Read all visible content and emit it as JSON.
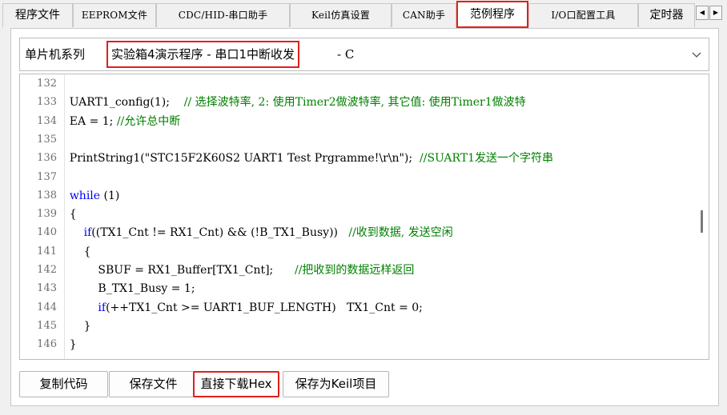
{
  "tabs": [
    {
      "label": "程序文件"
    },
    {
      "label": "EEPROM文件"
    },
    {
      "label": "CDC/HID-串口助手"
    },
    {
      "label": "Keil仿真设置"
    },
    {
      "label": "CAN助手"
    },
    {
      "label": "范例程序",
      "active": true
    },
    {
      "label": "I/O口配置工具"
    },
    {
      "label": "定时器"
    }
  ],
  "tab_scroll": {
    "left": "◀",
    "right": "▶"
  },
  "series": {
    "label": "单片机系列",
    "selected": "实验箱4演示程序 - 串口1中断收发",
    "suffix": "- C"
  },
  "code": {
    "lines": [
      {
        "n": "132",
        "code": ""
      },
      {
        "n": "133",
        "code": "    UART1_config(1);    ",
        "comment": "// 选择波特率, 2: 使用Timer2做波特率, 其它值: 使用Timer1做波特"
      },
      {
        "n": "134",
        "code": "    EA = 1; ",
        "comment": "//允许总中断"
      },
      {
        "n": "135",
        "code": ""
      },
      {
        "n": "136",
        "code": "    PrintString1(\"STC15F2K60S2 UART1 Test Prgramme!\\r\\n\");  ",
        "comment": "//SUART1发送一个字符串"
      },
      {
        "n": "137",
        "code": ""
      },
      {
        "n": "138",
        "kw": "while",
        "pre": "    ",
        "code": " (1)"
      },
      {
        "n": "139",
        "code": "    {"
      },
      {
        "n": "140",
        "kw": "if",
        "pre": "        ",
        "code": "((TX1_Cnt != RX1_Cnt) && (!B_TX1_Busy))   ",
        "comment": "//收到数据, 发送空闲"
      },
      {
        "n": "141",
        "code": "        {"
      },
      {
        "n": "142",
        "code": "            SBUF = RX1_Buffer[TX1_Cnt];      ",
        "comment": "//把收到的数据远样返回"
      },
      {
        "n": "143",
        "code": "            B_TX1_Busy = 1;"
      },
      {
        "n": "144",
        "kw": "if",
        "pre": "            ",
        "code": "(++TX1_Cnt >= UART1_BUF_LENGTH)   TX1_Cnt = 0;"
      },
      {
        "n": "145",
        "code": "        }"
      },
      {
        "n": "146",
        "code": "    }"
      }
    ]
  },
  "buttons": {
    "copy": "复制代码",
    "save": "保存文件",
    "download": "直接下载Hex",
    "save_keil": "保存为Keil项目"
  },
  "colors": {
    "highlight": "#e0201c",
    "keyword": "#0000ff",
    "comment": "#008000"
  }
}
